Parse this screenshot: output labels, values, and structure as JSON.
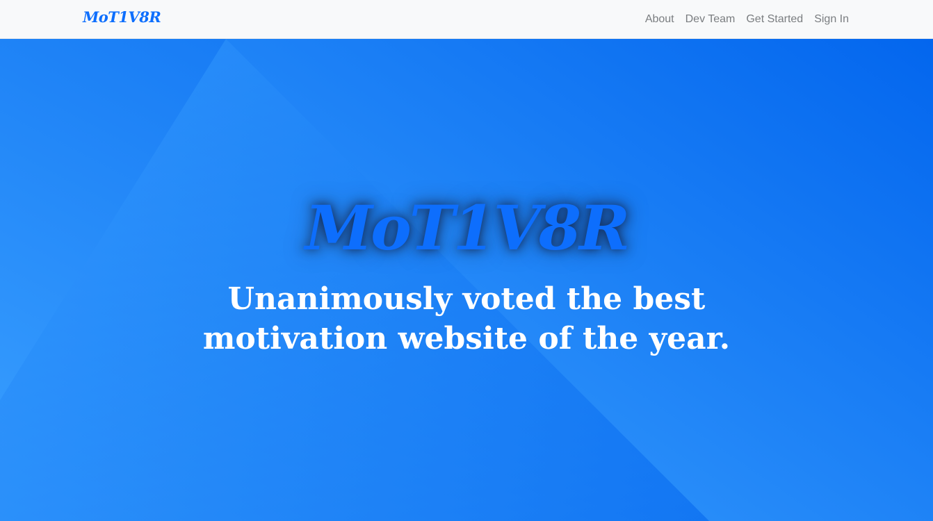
{
  "navbar": {
    "brand": "MoT1V8R",
    "links": [
      {
        "label": "About"
      },
      {
        "label": "Dev Team"
      },
      {
        "label": "Get Started"
      },
      {
        "label": "Sign In"
      }
    ]
  },
  "hero": {
    "title": "MoT1V8R",
    "tagline_line1": "Unanimously voted the best",
    "tagline_line2": "motivation website of the year."
  },
  "colors": {
    "brand": "#0d6efd",
    "navbar_bg": "#f8f9fa",
    "nav_link": "#7a7d80",
    "hero_light": "#3aa0ff",
    "hero_dark": "#0366ee",
    "tagline": "#ffffff"
  }
}
